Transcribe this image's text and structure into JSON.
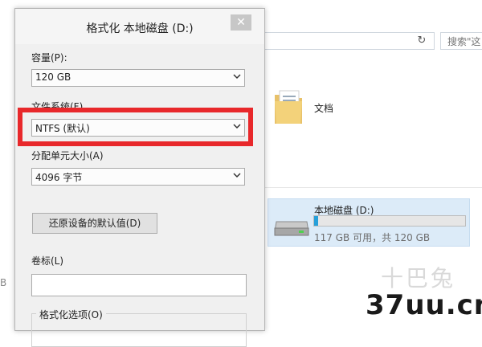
{
  "explorer": {
    "search_placeholder": "搜索\"这",
    "refresh_glyph": "↻",
    "left_fragment": "B",
    "folder_label": "文档",
    "drive": {
      "name": "本地磁盘 (D:)",
      "free_text": "117 GB 可用，共 120 GB",
      "used_fraction": 0.025
    }
  },
  "dialog": {
    "title": "格式化 本地磁盘 (D:)",
    "close_glyph": "✕",
    "capacity": {
      "label": "容量(P):",
      "value": "120 GB"
    },
    "filesystem": {
      "label": "文件系统(F)",
      "value": "NTFS (默认)"
    },
    "allocation": {
      "label": "分配单元大小(A)",
      "value": "4096 字节"
    },
    "restore_button": "还原设备的默认值(D)",
    "volume_label": {
      "label": "卷标(L)",
      "value": ""
    },
    "format_options_label": "格式化选项(O)"
  },
  "watermark": {
    "cn": "十巴兔",
    "text": "37uu.cn"
  },
  "colors": {
    "highlight": "#e8282b",
    "progress": "#26a0da",
    "tile": "#dcebf8"
  }
}
